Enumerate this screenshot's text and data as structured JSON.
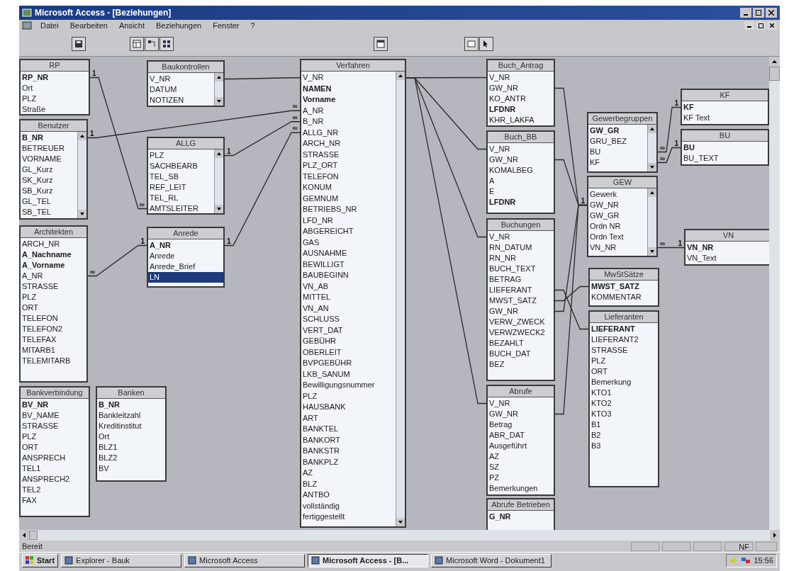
{
  "window": {
    "title": "Microsoft Access - [Beziehungen]"
  },
  "menu": [
    "Datei",
    "Bearbeiten",
    "Ansicht",
    "Beziehungen",
    "Fenster",
    "?"
  ],
  "tables": [
    {
      "title": "RP",
      "scroll": false,
      "fields": [
        {
          "name": "RP_NR",
          "bold": true,
          "selected": false
        },
        {
          "name": "Ort",
          "bold": false,
          "selected": false
        },
        {
          "name": "PLZ",
          "bold": false,
          "selected": false
        },
        {
          "name": "Straße",
          "bold": false,
          "selected": false
        }
      ]
    },
    {
      "title": "Benutzer",
      "scroll": true,
      "fields": [
        {
          "name": "B_NR",
          "bold": true,
          "selected": false
        },
        {
          "name": "BETREUER",
          "bold": false,
          "selected": false
        },
        {
          "name": "VORNAME",
          "bold": false,
          "selected": false
        },
        {
          "name": "GL_Kurz",
          "bold": false,
          "selected": false
        },
        {
          "name": "SK_Kurz",
          "bold": false,
          "selected": false
        },
        {
          "name": "SB_Kurz",
          "bold": false,
          "selected": false
        },
        {
          "name": "GL_TEL",
          "bold": false,
          "selected": false
        },
        {
          "name": "SB_TEL",
          "bold": false,
          "selected": false
        }
      ]
    },
    {
      "title": "Architekten",
      "scroll": false,
      "fields": [
        {
          "name": "ARCH_NR",
          "bold": false,
          "selected": false
        },
        {
          "name": "A_Nachname",
          "bold": true,
          "selected": false
        },
        {
          "name": "A_Vorname",
          "bold": true,
          "selected": false
        },
        {
          "name": "A_NR",
          "bold": false,
          "selected": false
        },
        {
          "name": "STRASSE",
          "bold": false,
          "selected": false
        },
        {
          "name": "PLZ",
          "bold": false,
          "selected": false
        },
        {
          "name": "ORT",
          "bold": false,
          "selected": false
        },
        {
          "name": "TELEFON",
          "bold": false,
          "selected": false
        },
        {
          "name": "TELEFON2",
          "bold": false,
          "selected": false
        },
        {
          "name": "TELEFAX",
          "bold": false,
          "selected": false
        },
        {
          "name": "MITARB1",
          "bold": false,
          "selected": false
        },
        {
          "name": "TELEMITARB",
          "bold": false,
          "selected": false
        }
      ]
    },
    {
      "title": "Bankverbindung",
      "scroll": false,
      "fields": [
        {
          "name": "BV_NR",
          "bold": true,
          "selected": false
        },
        {
          "name": "BV_NAME",
          "bold": false,
          "selected": false
        },
        {
          "name": "STRASSE",
          "bold": false,
          "selected": false
        },
        {
          "name": "PLZ",
          "bold": false,
          "selected": false
        },
        {
          "name": "ORT",
          "bold": false,
          "selected": false
        },
        {
          "name": "ANSPRECH",
          "bold": false,
          "selected": false
        },
        {
          "name": "TEL1",
          "bold": false,
          "selected": false
        },
        {
          "name": "ANSPRECH2",
          "bold": false,
          "selected": false
        },
        {
          "name": "TEL2",
          "bold": false,
          "selected": false
        },
        {
          "name": "FAX",
          "bold": false,
          "selected": false
        }
      ]
    },
    {
      "title": "Banken",
      "scroll": false,
      "fields": [
        {
          "name": "B_NR",
          "bold": true,
          "selected": false
        },
        {
          "name": "Bankleitzahl",
          "bold": false,
          "selected": false
        },
        {
          "name": "Kreditinstitut",
          "bold": false,
          "selected": false
        },
        {
          "name": "Ort",
          "bold": false,
          "selected": false
        },
        {
          "name": "BLZ1",
          "bold": false,
          "selected": false
        },
        {
          "name": "BLZ2",
          "bold": false,
          "selected": false
        },
        {
          "name": "BV",
          "bold": false,
          "selected": false
        }
      ]
    },
    {
      "title": "Baukontrollen",
      "scroll": true,
      "fields": [
        {
          "name": "V_NR",
          "bold": false,
          "selected": false
        },
        {
          "name": "DATUM",
          "bold": false,
          "selected": false
        },
        {
          "name": "NOTIZEN",
          "bold": false,
          "selected": false
        }
      ]
    },
    {
      "title": "ALLG",
      "scroll": true,
      "fields": [
        {
          "name": "PLZ",
          "bold": false,
          "selected": false
        },
        {
          "name": "SACHBEARB",
          "bold": false,
          "selected": false
        },
        {
          "name": "TEL_SB",
          "bold": false,
          "selected": false
        },
        {
          "name": "REF_LEIT",
          "bold": false,
          "selected": false
        },
        {
          "name": "TEL_RL",
          "bold": false,
          "selected": false
        },
        {
          "name": "AMTSLEITER",
          "bold": false,
          "selected": false
        }
      ]
    },
    {
      "title": "Anrede",
      "scroll": false,
      "fields": [
        {
          "name": "A_NR",
          "bold": true,
          "selected": false
        },
        {
          "name": "Anrede",
          "bold": false,
          "selected": false
        },
        {
          "name": "Anrede_Brief",
          "bold": false,
          "selected": false
        },
        {
          "name": "LN",
          "bold": false,
          "selected": true
        }
      ]
    },
    {
      "title": "Verfahren",
      "scroll": true,
      "fields": [
        {
          "name": "V_NR",
          "bold": false,
          "selected": false
        },
        {
          "name": "NAMEN",
          "bold": true,
          "selected": false
        },
        {
          "name": "Vorname",
          "bold": true,
          "selected": false
        },
        {
          "name": "A_NR",
          "bold": false,
          "selected": false
        },
        {
          "name": "B_NR",
          "bold": false,
          "selected": false
        },
        {
          "name": "ALLG_NR",
          "bold": false,
          "selected": false
        },
        {
          "name": "ARCH_NR",
          "bold": false,
          "selected": false
        },
        {
          "name": "STRASSE",
          "bold": false,
          "selected": false
        },
        {
          "name": "PLZ_ORT",
          "bold": false,
          "selected": false
        },
        {
          "name": "TELEFON",
          "bold": false,
          "selected": false
        },
        {
          "name": "KONUM",
          "bold": false,
          "selected": false
        },
        {
          "name": "GEMNUM",
          "bold": false,
          "selected": false
        },
        {
          "name": "BETRIEBS_NR",
          "bold": false,
          "selected": false
        },
        {
          "name": "LFD_NR",
          "bold": false,
          "selected": false
        },
        {
          "name": "ABGEREICHT",
          "bold": false,
          "selected": false
        },
        {
          "name": "GAS",
          "bold": false,
          "selected": false
        },
        {
          "name": "AUSNAHME",
          "bold": false,
          "selected": false
        },
        {
          "name": "BEWILLIGT",
          "bold": false,
          "selected": false
        },
        {
          "name": "BAUBEGINN",
          "bold": false,
          "selected": false
        },
        {
          "name": "VN_AB",
          "bold": false,
          "selected": false
        },
        {
          "name": "MITTEL",
          "bold": false,
          "selected": false
        },
        {
          "name": "VN_AN",
          "bold": false,
          "selected": false
        },
        {
          "name": "SCHLUSS",
          "bold": false,
          "selected": false
        },
        {
          "name": "VERT_DAT",
          "bold": false,
          "selected": false
        },
        {
          "name": "GEBÜHR",
          "bold": false,
          "selected": false
        },
        {
          "name": "OBERLEIT",
          "bold": false,
          "selected": false
        },
        {
          "name": "BVPGEBÜHR",
          "bold": false,
          "selected": false
        },
        {
          "name": "LKB_SANUM",
          "bold": false,
          "selected": false
        },
        {
          "name": "Bewilligungsnummer",
          "bold": false,
          "selected": false
        },
        {
          "name": "PLZ",
          "bold": false,
          "selected": false
        },
        {
          "name": "HAUSBANK",
          "bold": false,
          "selected": false
        },
        {
          "name": "ART",
          "bold": false,
          "selected": false
        },
        {
          "name": "BANKTEL",
          "bold": false,
          "selected": false
        },
        {
          "name": "BANKORT",
          "bold": false,
          "selected": false
        },
        {
          "name": "BANKSTR",
          "bold": false,
          "selected": false
        },
        {
          "name": "BANKPLZ",
          "bold": false,
          "selected": false
        },
        {
          "name": "AZ",
          "bold": false,
          "selected": false
        },
        {
          "name": "BLZ",
          "bold": false,
          "selected": false
        },
        {
          "name": "ANTBO",
          "bold": false,
          "selected": false
        },
        {
          "name": "vollständig",
          "bold": false,
          "selected": false
        },
        {
          "name": "fertiggestellt",
          "bold": false,
          "selected": false
        }
      ]
    },
    {
      "title": "Buch_Antrag",
      "scroll": false,
      "fields": [
        {
          "name": "V_NR",
          "bold": false,
          "selected": false
        },
        {
          "name": "GW_NR",
          "bold": false,
          "selected": false
        },
        {
          "name": "KO_ANTR",
          "bold": false,
          "selected": false
        },
        {
          "name": "LFDNR",
          "bold": true,
          "selected": false
        },
        {
          "name": "KHR_LAKFA",
          "bold": false,
          "selected": false
        }
      ]
    },
    {
      "title": "Buch_BB",
      "scroll": false,
      "fields": [
        {
          "name": "V_NR",
          "bold": false,
          "selected": false
        },
        {
          "name": "GW_NR",
          "bold": false,
          "selected": false
        },
        {
          "name": "KOMALBEG",
          "bold": false,
          "selected": false
        },
        {
          "name": "A",
          "bold": false,
          "selected": false
        },
        {
          "name": "E",
          "bold": false,
          "selected": false
        },
        {
          "name": "LFDNR",
          "bold": true,
          "selected": false
        }
      ]
    },
    {
      "title": "Buchungen",
      "scroll": false,
      "fields": [
        {
          "name": "V_NR",
          "bold": false,
          "selected": false
        },
        {
          "name": "RN_DATUM",
          "bold": false,
          "selected": false
        },
        {
          "name": "RN_NR",
          "bold": false,
          "selected": false
        },
        {
          "name": "BUCH_TEXT",
          "bold": false,
          "selected": false
        },
        {
          "name": "BETRAG",
          "bold": false,
          "selected": false
        },
        {
          "name": "LIEFERANT",
          "bold": false,
          "selected": false
        },
        {
          "name": "MWST_SATZ",
          "bold": false,
          "selected": false
        },
        {
          "name": "GW_NR",
          "bold": false,
          "selected": false
        },
        {
          "name": "VERW_ZWECK",
          "bold": false,
          "selected": false
        },
        {
          "name": "VERWZWECK2",
          "bold": false,
          "selected": false
        },
        {
          "name": "BEZAHLT",
          "bold": false,
          "selected": false
        },
        {
          "name": "BUCH_DAT",
          "bold": false,
          "selected": false
        },
        {
          "name": "BEZ",
          "bold": false,
          "selected": false
        }
      ]
    },
    {
      "title": "Abrufe",
      "scroll": false,
      "fields": [
        {
          "name": "V_NR",
          "bold": false,
          "selected": false
        },
        {
          "name": "GW_NR",
          "bold": false,
          "selected": false
        },
        {
          "name": "Betrag",
          "bold": false,
          "selected": false
        },
        {
          "name": "ABR_DAT",
          "bold": false,
          "selected": false
        },
        {
          "name": "Ausgeführt",
          "bold": false,
          "selected": false
        },
        {
          "name": "AZ",
          "bold": false,
          "selected": false
        },
        {
          "name": "SZ",
          "bold": false,
          "selected": false
        },
        {
          "name": "PZ",
          "bold": false,
          "selected": false
        },
        {
          "name": "Bemerkungen",
          "bold": false,
          "selected": false
        }
      ]
    },
    {
      "title": "Abrufe Betrieben",
      "scroll": false,
      "fields": [
        {
          "name": "G_NR",
          "bold": true,
          "selected": false
        }
      ]
    },
    {
      "title": "Gewerbegruppen",
      "scroll": true,
      "fields": [
        {
          "name": "GW_GR",
          "bold": true,
          "selected": false
        },
        {
          "name": "GRU_BEZ",
          "bold": false,
          "selected": false
        },
        {
          "name": "BU",
          "bold": false,
          "selected": false
        },
        {
          "name": "KF",
          "bold": false,
          "selected": false
        }
      ]
    },
    {
      "title": "GEW",
      "scroll": true,
      "fields": [
        {
          "name": "Gewerk",
          "bold": false,
          "selected": false
        },
        {
          "name": "GW_NR",
          "bold": false,
          "selected": false
        },
        {
          "name": "GW_GR",
          "bold": false,
          "selected": false
        },
        {
          "name": "Ordn NR",
          "bold": false,
          "selected": false
        },
        {
          "name": "Ordn Text",
          "bold": false,
          "selected": false
        },
        {
          "name": "VN_NR",
          "bold": false,
          "selected": false
        }
      ]
    },
    {
      "title": "KF",
      "scroll": false,
      "fields": [
        {
          "name": "KF",
          "bold": true,
          "selected": false
        },
        {
          "name": "KF Text",
          "bold": false,
          "selected": false
        }
      ]
    },
    {
      "title": "BU",
      "scroll": false,
      "fields": [
        {
          "name": "BU",
          "bold": true,
          "selected": false
        },
        {
          "name": "BU_TEXT",
          "bold": false,
          "selected": false
        }
      ]
    },
    {
      "title": "VN",
      "scroll": false,
      "fields": [
        {
          "name": "VN_NR",
          "bold": true,
          "selected": false
        },
        {
          "name": "VN_Text",
          "bold": false,
          "selected": false
        }
      ]
    },
    {
      "title": "MwStSätze",
      "scroll": false,
      "fields": [
        {
          "name": "MWST_SATZ",
          "bold": true,
          "selected": false
        },
        {
          "name": "KOMMENTAR",
          "bold": false,
          "selected": false
        }
      ]
    },
    {
      "title": "Lieferanten",
      "scroll": false,
      "fields": [
        {
          "name": "LIEFERANT",
          "bold": true,
          "selected": false
        },
        {
          "name": "LIEFERANT2",
          "bold": false,
          "selected": false
        },
        {
          "name": "STRASSE",
          "bold": false,
          "selected": false
        },
        {
          "name": "PLZ",
          "bold": false,
          "selected": false
        },
        {
          "name": "ORT",
          "bold": false,
          "selected": false
        },
        {
          "name": "Bemerkung",
          "bold": false,
          "selected": false
        },
        {
          "name": "KTO1",
          "bold": false,
          "selected": false
        },
        {
          "name": "KTO2",
          "bold": false,
          "selected": false
        },
        {
          "name": "KTO3",
          "bold": false,
          "selected": false
        },
        {
          "name": "B1",
          "bold": false,
          "selected": false
        },
        {
          "name": "B2",
          "bold": false,
          "selected": false
        },
        {
          "name": "B3",
          "bold": false,
          "selected": false
        }
      ]
    }
  ],
  "relationships": [
    {
      "from_label": "1",
      "to_label": "∞"
    },
    {
      "from_label": "1",
      "to_label": "∞"
    },
    {
      "from_label": "1",
      "to_label": "∞"
    },
    {
      "from_label": "1",
      "to_label": "∞"
    },
    {
      "from_label": "∞",
      "to_label": "1"
    },
    {
      "to_label": "1"
    },
    {
      "from_label": "∞",
      "to_label": "1"
    },
    {
      "from_label": "∞",
      "to_label": "1"
    },
    {
      "from_label": "∞",
      "to_label": "1"
    }
  ],
  "status_bar": {
    "text": "Bereit",
    "indicator": "NF"
  },
  "taskbar": {
    "start": "Start",
    "tasks": [
      {
        "label": "Explorer - Bauk",
        "selected": false
      },
      {
        "label": "Microsoft Access",
        "selected": false
      },
      {
        "label": "Microsoft Access - [B...",
        "selected": true
      },
      {
        "label": "Microsoft Word - Dokument1",
        "selected": false
      }
    ],
    "clock": "15:56"
  }
}
